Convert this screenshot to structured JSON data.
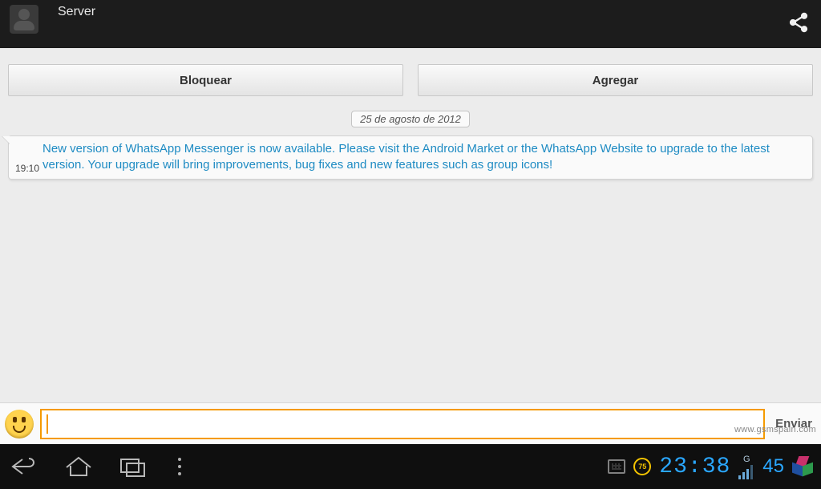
{
  "header": {
    "title": "Server"
  },
  "top_buttons": {
    "block": "Bloquear",
    "add": "Agregar"
  },
  "date_badge": "25 de agosto de 2012",
  "messages": [
    {
      "time": "19:10",
      "text": "New version of WhatsApp Messenger is now available. Please visit the Android Market or the WhatsApp Website to upgrade to the latest version. Your upgrade will bring improvements, bug fixes and new features such as group icons!"
    }
  ],
  "composer": {
    "value": "",
    "send_label": "Enviar"
  },
  "statusbar": {
    "battery_pct": "75",
    "clock": "23:38",
    "net_label": "G",
    "signal_value": "45"
  },
  "watermark": "www.gsmspain.com"
}
